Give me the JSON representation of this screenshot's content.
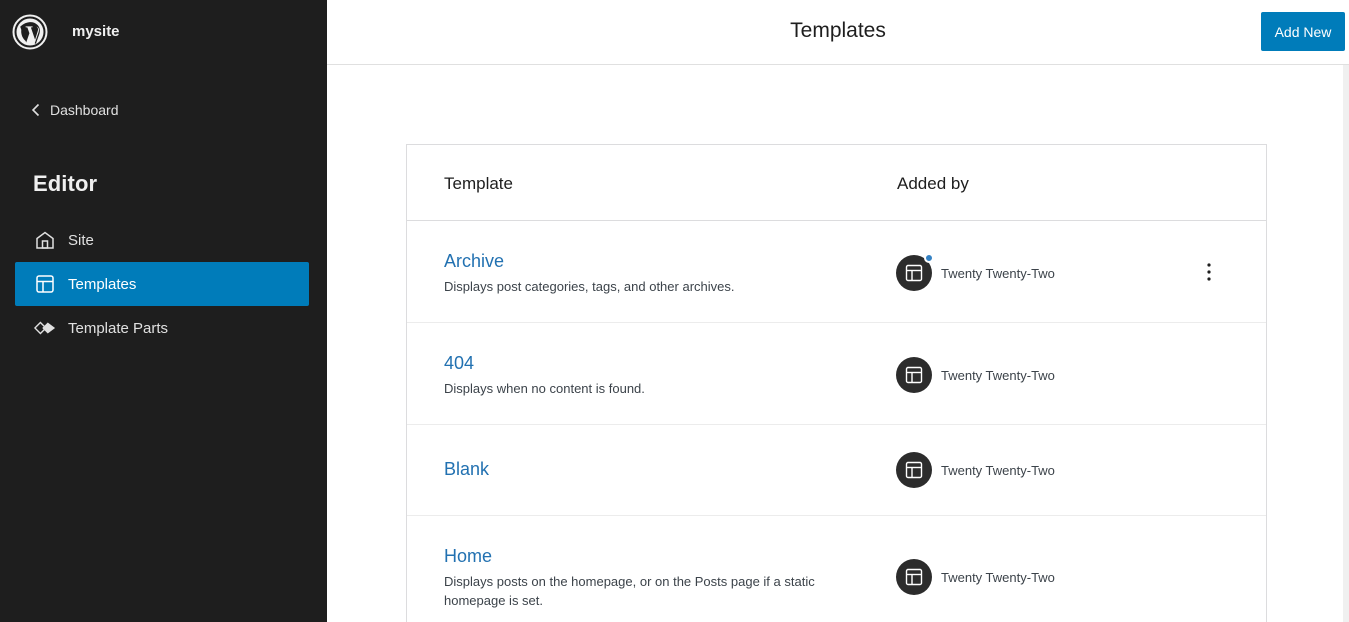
{
  "site": {
    "name": "mysite"
  },
  "sidebar": {
    "back_label": "Dashboard",
    "section_title": "Editor",
    "items": [
      {
        "label": "Site",
        "icon": "home-icon",
        "active": false
      },
      {
        "label": "Templates",
        "icon": "layout-icon",
        "active": true
      },
      {
        "label": "Template Parts",
        "icon": "symbol-filled-icon",
        "active": false
      }
    ]
  },
  "header": {
    "title": "Templates",
    "add_new_label": "Add New"
  },
  "table": {
    "columns": [
      "Template",
      "Added by"
    ],
    "rows": [
      {
        "title": "Archive",
        "description": "Displays post categories, tags, and other archives.",
        "added_by": "Twenty Twenty-Two"
      },
      {
        "title": "404",
        "description": "Displays when no content is found.",
        "added_by": "Twenty Twenty-Two"
      },
      {
        "title": "Blank",
        "description": "",
        "added_by": "Twenty Twenty-Two"
      },
      {
        "title": "Home",
        "description": "Displays posts on the homepage, or on the Posts page if a static homepage is set.",
        "added_by": "Twenty Twenty-Two"
      }
    ]
  },
  "colors": {
    "accent": "#007cba",
    "link": "#2271b1",
    "sidebar_bg": "#1e1e1e"
  }
}
